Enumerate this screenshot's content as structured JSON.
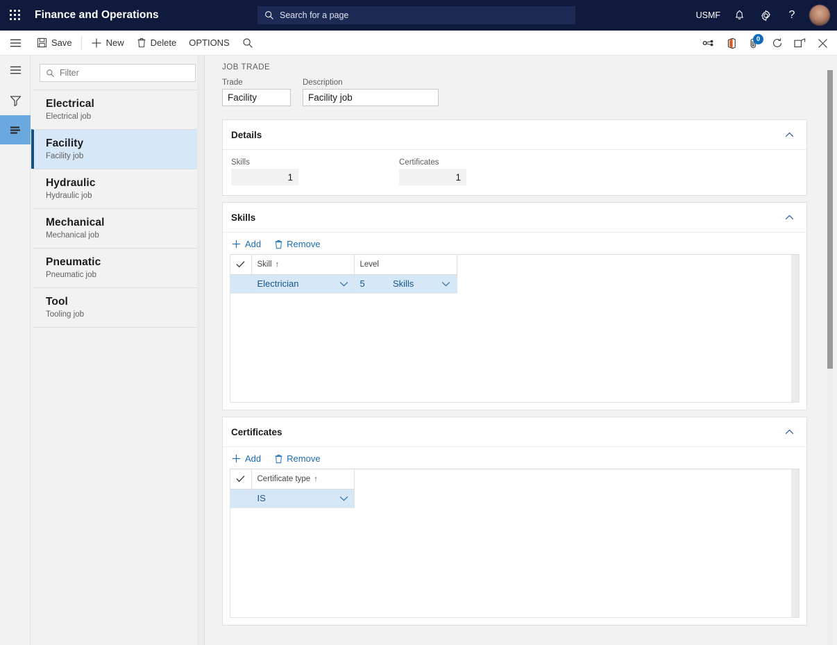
{
  "topbar": {
    "waffle_label": "app-launcher",
    "app_title": "Finance and Operations",
    "search_placeholder": "Search for a page",
    "company": "USMF",
    "notifications_icon": "bell-icon",
    "settings_icon": "gear-icon",
    "help_icon": "help-icon",
    "avatar_label": "user-avatar"
  },
  "commandbar": {
    "save_label": "Save",
    "new_label": "New",
    "delete_label": "Delete",
    "options_label": "OPTIONS",
    "search_icon": "search-icon",
    "right_icons": [
      {
        "name": "share-icon"
      },
      {
        "name": "office-app-icon"
      },
      {
        "name": "attachments-icon",
        "badge": "0"
      },
      {
        "name": "refresh-icon"
      },
      {
        "name": "popout-icon"
      },
      {
        "name": "close-icon"
      }
    ]
  },
  "rail": {
    "menu_icon": "hamburger-menu-icon",
    "filter_icon": "filter-funnel-icon",
    "list_icon": "list-panel-icon"
  },
  "sidebar": {
    "filter_placeholder": "Filter",
    "items": [
      {
        "title": "Electrical",
        "subtitle": "Electrical job",
        "selected": false
      },
      {
        "title": "Facility",
        "subtitle": "Facility job",
        "selected": true
      },
      {
        "title": "Hydraulic",
        "subtitle": "Hydraulic job",
        "selected": false
      },
      {
        "title": "Mechanical",
        "subtitle": "Mechanical job",
        "selected": false
      },
      {
        "title": "Pneumatic",
        "subtitle": "Pneumatic job",
        "selected": false
      },
      {
        "title": "Tool",
        "subtitle": "Tooling job",
        "selected": false
      }
    ]
  },
  "page": {
    "caption": "JOB TRADE",
    "trade_label": "Trade",
    "trade_value": "Facility",
    "description_label": "Description",
    "description_value": "Facility job"
  },
  "details": {
    "title": "Details",
    "skills_label": "Skills",
    "skills_value": "1",
    "certificates_label": "Certificates",
    "certificates_value": "1"
  },
  "skills": {
    "title": "Skills",
    "add_label": "Add",
    "remove_label": "Remove",
    "columns": [
      "Skill",
      "Level"
    ],
    "sort_column": "Skill",
    "sort_arrow": "↑",
    "rows": [
      {
        "skill": "Electrician",
        "level": "5",
        "level_unit": "Skills",
        "selected": true
      }
    ]
  },
  "certificates": {
    "title": "Certificates",
    "add_label": "Add",
    "remove_label": "Remove",
    "columns": [
      "Certificate type"
    ],
    "sort_column": "Certificate type",
    "sort_arrow": "↑",
    "rows": [
      {
        "certificate_type": "IS",
        "selected": true
      }
    ]
  },
  "colors": {
    "topbar_bg": "#0f1a3d",
    "accent_link": "#1a6cb5",
    "selection_bg": "#d6e7f7",
    "selection_border": "#12508f",
    "rail_active": "#6ba8e0",
    "badge_bg": "#0f6cbd"
  }
}
